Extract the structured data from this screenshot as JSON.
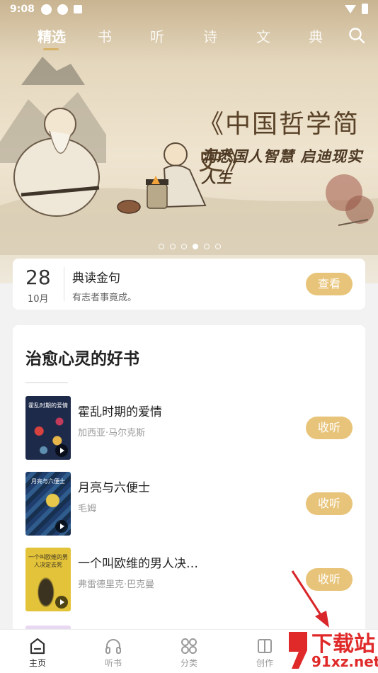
{
  "status_bar": {
    "time": "9:08"
  },
  "top_nav": {
    "tabs": [
      {
        "label": "精选",
        "active": true
      },
      {
        "label": "书"
      },
      {
        "label": "听"
      },
      {
        "label": "诗"
      },
      {
        "label": "文"
      },
      {
        "label": "典"
      }
    ],
    "search_icon": "search-icon"
  },
  "banner": {
    "title": "《中国哲学简史》",
    "subtitle": "洞悉国人智慧  启迪现实人生",
    "dots_count": 6,
    "active_dot": 3
  },
  "daily_quote": {
    "day": "28",
    "month": "10月",
    "title": "典读金句",
    "text": "有志者事竟成。",
    "button": "查看"
  },
  "section": {
    "title": "治愈心灵的好书",
    "books": [
      {
        "title": "霍乱时期的爱情",
        "author": "加西亚·马尔克斯",
        "cover_text": "霍乱时期的爱情",
        "button": "收听"
      },
      {
        "title": "月亮与六便士",
        "author": "毛姆",
        "cover_text": "月亮与六便士",
        "button": "收听"
      },
      {
        "title": "一个叫欧维的男人决…",
        "author": "弗雷德里克·巴克曼",
        "cover_text": "一个叫欧维的男人决定去死",
        "button": "收听"
      }
    ]
  },
  "bottom_nav": [
    {
      "label": "主页",
      "icon": "home-icon",
      "active": true
    },
    {
      "label": "听书",
      "icon": "headphones-icon"
    },
    {
      "label": "分类",
      "icon": "grid-icon"
    },
    {
      "label": "创作",
      "icon": "book-icon"
    }
  ],
  "watermark": {
    "line1": "下载站",
    "line2": "91xz.net"
  },
  "colors": {
    "accent": "#e8c47a",
    "tab_underline": "#d7b36a",
    "watermark": "#e02a2a"
  }
}
